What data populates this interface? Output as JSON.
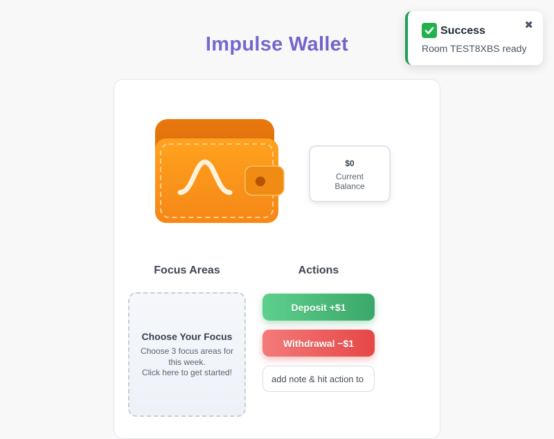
{
  "header": {
    "title": "Impulse Wallet"
  },
  "wallet": {
    "icon": "wallet-icon",
    "brand_color": "#f7941d"
  },
  "balance": {
    "amount": "$0",
    "label": "Current Balance"
  },
  "focus": {
    "heading": "Focus Areas",
    "title": "Choose Your Focus",
    "description_line1": "Choose 3 focus areas for this week.",
    "description_line2": "Click here to get started!"
  },
  "actions": {
    "heading": "Actions",
    "deposit_label": "Deposit +$1",
    "withdraw_label": "Withdrawal −$1",
    "note_placeholder": "add note & hit action to save"
  },
  "toast": {
    "icon": "check-icon",
    "title": "Success",
    "message": "Room TEST8XBS ready",
    "close_icon": "close-icon",
    "close_glyph": "✖",
    "accent": "#1f9d55"
  },
  "colors": {
    "deposit": "#3aa868",
    "withdraw": "#e64646",
    "title": "#6f74e0"
  }
}
